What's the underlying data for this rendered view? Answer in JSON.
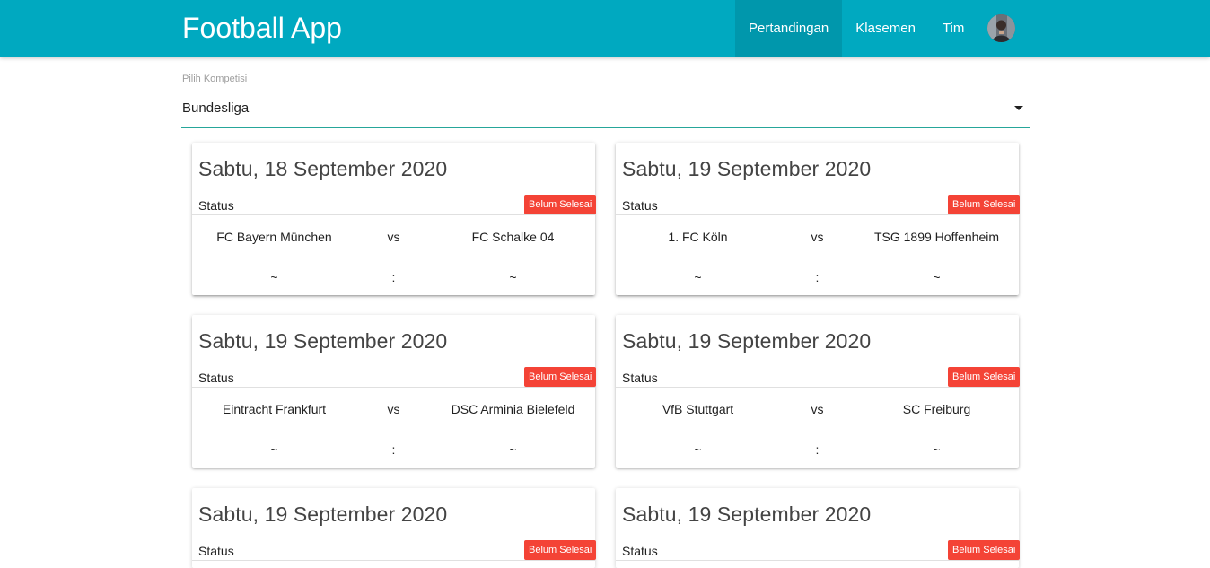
{
  "navbar": {
    "brand": "Football App",
    "links": [
      {
        "label": "Pertandingan",
        "active": true
      },
      {
        "label": "Klasemen",
        "active": false
      },
      {
        "label": "Tim",
        "active": false
      }
    ],
    "avatar_icon": "user-avatar",
    "color": "#00a9c0"
  },
  "competition_select": {
    "label": "Pilih Kompetisi",
    "value": "Bundesliga",
    "icon": "caret-down-icon"
  },
  "matches": [
    {
      "date": "Sabtu, 18 September 2020",
      "status_label": "Status",
      "status": "Belum Selesai",
      "home": "FC Bayern München",
      "vs": "vs",
      "away": "FC Schalke 04",
      "home_score": "~",
      "separator": ":",
      "away_score": "~"
    },
    {
      "date": "Sabtu, 19 September 2020",
      "status_label": "Status",
      "status": "Belum Selesai",
      "home": "1. FC Köln",
      "vs": "vs",
      "away": "TSG 1899 Hoffenheim",
      "home_score": "~",
      "separator": ":",
      "away_score": "~"
    },
    {
      "date": "Sabtu, 19 September 2020",
      "status_label": "Status",
      "status": "Belum Selesai",
      "home": "Eintracht Frankfurt",
      "vs": "vs",
      "away": "DSC Arminia Bielefeld",
      "home_score": "~",
      "separator": ":",
      "away_score": "~"
    },
    {
      "date": "Sabtu, 19 September 2020",
      "status_label": "Status",
      "status": "Belum Selesai",
      "home": "VfB Stuttgart",
      "vs": "vs",
      "away": "SC Freiburg",
      "home_score": "~",
      "separator": ":",
      "away_score": "~"
    },
    {
      "date": "Sabtu, 19 September 2020",
      "status_label": "Status",
      "status": "Belum Selesai"
    },
    {
      "date": "Sabtu, 19 September 2020",
      "status_label": "Status",
      "status": "Belum Selesai"
    }
  ],
  "colors": {
    "status_badge": "#f44336",
    "select_underline": "#26a69a"
  }
}
